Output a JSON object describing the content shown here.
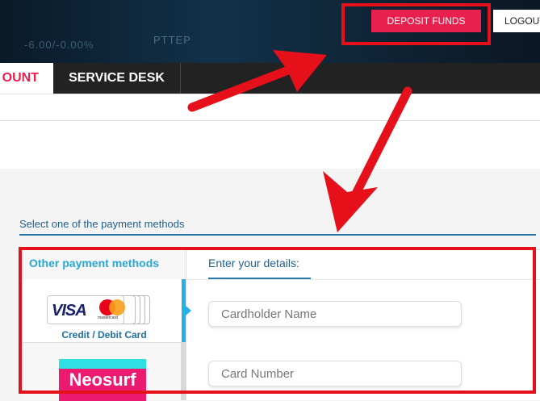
{
  "header": {
    "deposit_label": "DEPOSIT FUNDS",
    "logout_label": "LOGOUT"
  },
  "nav": {
    "account_label": "MY ACCOUNT",
    "account_visible": "OUNT",
    "service_label": "SERVICE DESK"
  },
  "payment": {
    "select_label": "Select one of the payment methods",
    "other_title": "Other payment methods",
    "details_title": "Enter your details:",
    "methods": [
      {
        "label": "Credit / Debit Card",
        "brand_visa": "VISA",
        "brand_mc": "mastercard"
      },
      {
        "label": "Neosurf",
        "brand": "Neosurf"
      }
    ]
  },
  "form": {
    "cardholder_placeholder": "Cardholder Name",
    "card_number_placeholder": "Card Number"
  },
  "annotation": {
    "highlight_color": "#e5101a",
    "accent_color": "#e8204d",
    "link_color": "#24b2e6"
  }
}
